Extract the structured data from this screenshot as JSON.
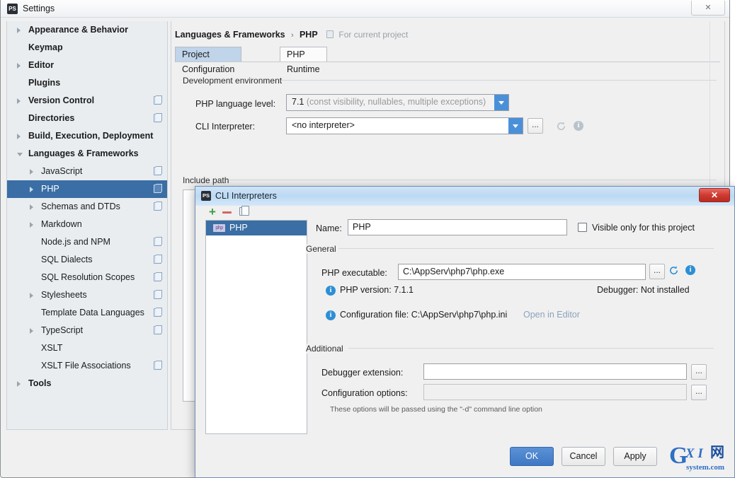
{
  "window": {
    "title": "Settings",
    "icon": "phpstorm-icon",
    "close_label": "✕"
  },
  "search": {
    "value": "",
    "placeholder": "",
    "icon": "search-icon"
  },
  "sidebar": {
    "items": [
      {
        "label": "Appearance & Behavior",
        "indent": 0,
        "bold": true,
        "arrow": "collapsed",
        "badge": false,
        "selected": false
      },
      {
        "label": "Keymap",
        "indent": 0,
        "bold": true,
        "arrow": "none",
        "badge": false,
        "selected": false
      },
      {
        "label": "Editor",
        "indent": 0,
        "bold": true,
        "arrow": "collapsed",
        "badge": false,
        "selected": false
      },
      {
        "label": "Plugins",
        "indent": 0,
        "bold": true,
        "arrow": "none",
        "badge": false,
        "selected": false
      },
      {
        "label": "Version Control",
        "indent": 0,
        "bold": true,
        "arrow": "collapsed",
        "badge": true,
        "selected": false
      },
      {
        "label": "Directories",
        "indent": 0,
        "bold": true,
        "arrow": "none",
        "badge": true,
        "selected": false
      },
      {
        "label": "Build, Execution, Deployment",
        "indent": 0,
        "bold": true,
        "arrow": "collapsed",
        "badge": false,
        "selected": false
      },
      {
        "label": "Languages & Frameworks",
        "indent": 0,
        "bold": true,
        "arrow": "expanded",
        "badge": false,
        "selected": false
      },
      {
        "label": "JavaScript",
        "indent": 1,
        "bold": false,
        "arrow": "collapsed",
        "badge": true,
        "selected": false
      },
      {
        "label": "PHP",
        "indent": 1,
        "bold": false,
        "arrow": "collapsed",
        "badge": true,
        "selected": true
      },
      {
        "label": "Schemas and DTDs",
        "indent": 1,
        "bold": false,
        "arrow": "collapsed",
        "badge": true,
        "selected": false
      },
      {
        "label": "Markdown",
        "indent": 1,
        "bold": false,
        "arrow": "collapsed",
        "badge": false,
        "selected": false
      },
      {
        "label": "Node.js and NPM",
        "indent": 1,
        "bold": false,
        "arrow": "none",
        "badge": true,
        "selected": false
      },
      {
        "label": "SQL Dialects",
        "indent": 1,
        "bold": false,
        "arrow": "none",
        "badge": true,
        "selected": false
      },
      {
        "label": "SQL Resolution Scopes",
        "indent": 1,
        "bold": false,
        "arrow": "none",
        "badge": true,
        "selected": false
      },
      {
        "label": "Stylesheets",
        "indent": 1,
        "bold": false,
        "arrow": "collapsed",
        "badge": true,
        "selected": false
      },
      {
        "label": "Template Data Languages",
        "indent": 1,
        "bold": false,
        "arrow": "none",
        "badge": true,
        "selected": false
      },
      {
        "label": "TypeScript",
        "indent": 1,
        "bold": false,
        "arrow": "collapsed",
        "badge": true,
        "selected": false
      },
      {
        "label": "XSLT",
        "indent": 1,
        "bold": false,
        "arrow": "none",
        "badge": false,
        "selected": false
      },
      {
        "label": "XSLT File Associations",
        "indent": 1,
        "bold": false,
        "arrow": "none",
        "badge": true,
        "selected": false
      },
      {
        "label": "Tools",
        "indent": 0,
        "bold": true,
        "arrow": "collapsed",
        "badge": false,
        "selected": false
      }
    ]
  },
  "content": {
    "breadcrumb_root": "Languages & Frameworks",
    "breadcrumb_sep": "›",
    "breadcrumb_leaf": "PHP",
    "scope_note": "For current project",
    "tabs": [
      {
        "label": "Project Configuration",
        "active": true
      },
      {
        "label": "PHP Runtime",
        "active": false
      }
    ],
    "dev_env_group": "Development environment",
    "php_level_label": "PHP language level:",
    "php_level_value": "7.1",
    "php_level_detail": "(const visibility, nullables, multiple exceptions)",
    "cli_interpreter_label": "CLI Interpreter:",
    "cli_interpreter_value": "<no interpreter>",
    "browse_label": "...",
    "refresh_icon": "refresh-icon",
    "info_icon": "info-icon",
    "include_path_group": "Include path",
    "add_label": "+"
  },
  "modal": {
    "title": "CLI Interpreters",
    "icon": "phpstorm-icon",
    "close_label": "✕",
    "toolbar": {
      "add": "+",
      "remove": "−",
      "copy": "copy-icon"
    },
    "list": [
      {
        "label": "PHP",
        "icon": "php-icon",
        "selected": true
      }
    ],
    "name_label": "Name:",
    "name_value": "PHP",
    "visible_only_label": "Visible only for this project",
    "visible_only_checked": false,
    "general_group": "General",
    "php_executable_label": "PHP executable:",
    "php_executable_value": "C:\\AppServ\\php7\\php.exe",
    "browse_label": "...",
    "php_version_text": "PHP version: 7.1.1",
    "debugger_text": "Debugger: Not installed",
    "config_file_text": "Configuration file: C:\\AppServ\\php7\\php.ini",
    "open_in_editor_link": "Open in Editor",
    "additional_group": "Additional",
    "debugger_extension_label": "Debugger extension:",
    "debugger_extension_value": "",
    "configuration_options_label": "Configuration options:",
    "configuration_options_value": "",
    "options_hint": "These options will be passed using the \"-d\" command line option",
    "buttons": {
      "ok": "OK",
      "cancel": "Cancel",
      "apply": "Apply"
    }
  },
  "watermark": {
    "g": "G",
    "xi": "X I",
    "cn": "网",
    "sub": "system.com"
  },
  "colors": {
    "selection_blue": "#3a6ea5",
    "accent_blue": "#4a90d9",
    "primary_button": "#3f77c4",
    "close_red": "#cf3a30",
    "add_green": "#3f9c3f",
    "remove_red": "#d4675e",
    "info_blue": "#2d8fd5"
  }
}
